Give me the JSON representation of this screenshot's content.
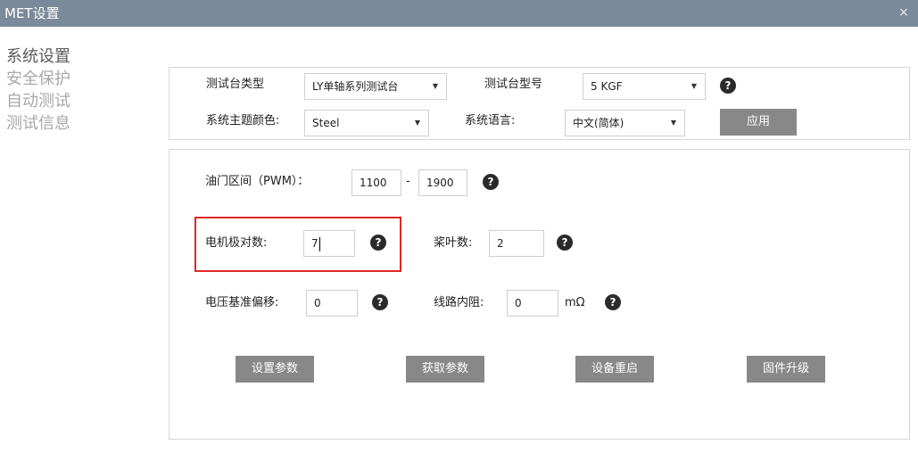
{
  "window": {
    "title": "MET设置",
    "close_symbol": "×"
  },
  "sidebar": {
    "items": [
      {
        "label": "系统设置",
        "active": true
      },
      {
        "label": "安全保护",
        "active": false
      },
      {
        "label": "自动测试",
        "active": false
      },
      {
        "label": "测试信息",
        "active": false
      }
    ]
  },
  "top_panel": {
    "bench_type_label": "测试台类型",
    "bench_type_value": "LY单轴系列测试台",
    "bench_model_label": "测试台型号",
    "bench_model_value": "5 KGF",
    "theme_label": "系统主题颜色:",
    "theme_value": "Steel",
    "language_label": "系统语言:",
    "language_value": "中文(简体)",
    "apply_button": "应用"
  },
  "main_panel": {
    "throttle_label": "油门区间（PWM）：",
    "throttle_min": "1100",
    "throttle_separator": "-",
    "throttle_max": "1900",
    "pole_pairs_label": "电机极对数:",
    "pole_pairs_value": "7",
    "blade_count_label": "桨叶数:",
    "blade_count_value": "2",
    "voltage_offset_label": "电压基准偏移:",
    "voltage_offset_value": "0",
    "line_resistance_label": "线路内阻:",
    "line_resistance_value": "0",
    "line_resistance_unit": "mΩ",
    "help_symbol": "?",
    "buttons": {
      "set_params": "设置参数",
      "get_params": "获取参数",
      "reboot_device": "设备重启",
      "firmware_upgrade": "固件升级"
    }
  },
  "colors": {
    "titlebar": "#7a8a9a",
    "button": "#888888",
    "highlight": "#e0262a"
  }
}
